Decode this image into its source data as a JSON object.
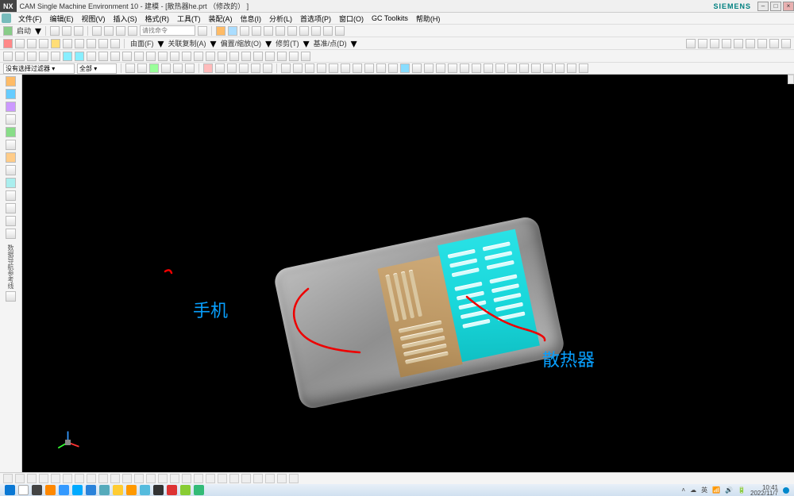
{
  "title": {
    "app_prefix": "NX",
    "text": "CAM Single Machine Environment 10 - 建模 - [散热器he.prt （修改的） ]",
    "brand": "SIEMENS"
  },
  "window_controls": {
    "min": "–",
    "max": "□",
    "close": "×"
  },
  "menu": {
    "items": [
      "文件(F)",
      "编辑(E)",
      "视图(V)",
      "插入(S)",
      "格式(R)",
      "工具(T)",
      "装配(A)",
      "信息(I)",
      "分析(L)",
      "首选项(P)",
      "窗口(O)",
      "GC Toolkits",
      "帮助(H)"
    ]
  },
  "toolbar1": {
    "start_label": "启动",
    "cmd_input_placeholder": "请找命令",
    "icons": [
      "new",
      "open",
      "save",
      "undo",
      "redo",
      "cut",
      "copy",
      "paste",
      "i1",
      "i2",
      "i3",
      "i4",
      "i5",
      "i6",
      "i7",
      "i8",
      "i9",
      "i10",
      "i11",
      "i12",
      "i13",
      "i14"
    ]
  },
  "toolbar2": {
    "labels": [
      "由面(F)",
      "关联复制(A)",
      "偏置/缩放(O)",
      "修剪(T)",
      "基准/点(D)"
    ],
    "icons": [
      "a",
      "b",
      "c",
      "d",
      "e",
      "f",
      "g",
      "h",
      "i",
      "j",
      "k",
      "l",
      "m",
      "n",
      "o",
      "p",
      "q",
      "r",
      "s",
      "t",
      "u",
      "v",
      "w",
      "x",
      "y",
      "z",
      "aa",
      "bb",
      "cc",
      "dd",
      "ee",
      "ff",
      "gg",
      "hh"
    ]
  },
  "filterbar": {
    "filter_label": "没有选择过滤器",
    "scope_label": "全部"
  },
  "canvas": {
    "annotations": {
      "phone": "手机",
      "heatsink": "散热器"
    }
  },
  "sidebar": {
    "vertical_text": "数据导航参考线"
  },
  "tray": {
    "ime": "英",
    "time": "10:41",
    "date": "2022/11/7"
  }
}
